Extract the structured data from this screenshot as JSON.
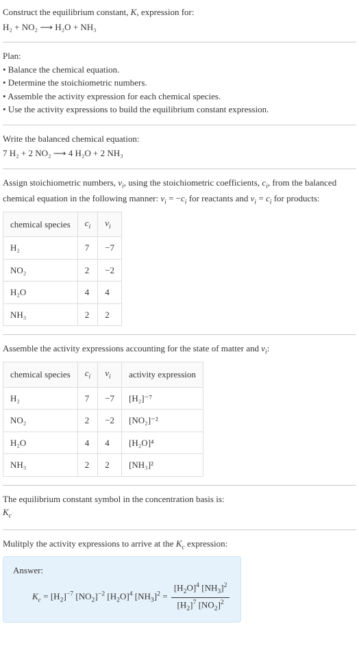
{
  "intro": {
    "line1": "Construct the equilibrium constant, K, expression for:",
    "equation": "H₂ + NO₂ ⟶ H₂O + NH₃"
  },
  "plan": {
    "heading": "Plan:",
    "b1": "• Balance the chemical equation.",
    "b2": "• Determine the stoichiometric numbers.",
    "b3": "• Assemble the activity expression for each chemical species.",
    "b4": "• Use the activity expressions to build the equilibrium constant expression."
  },
  "balanced": {
    "heading": "Write the balanced chemical equation:",
    "equation": "7 H₂ + 2 NO₂ ⟶ 4 H₂O + 2 NH₃"
  },
  "stoich": {
    "intro_a": "Assign stoichiometric numbers, νᵢ, using the stoichiometric coefficients, cᵢ, from the balanced chemical equation in the following manner: νᵢ = −cᵢ for reactants and νᵢ = cᵢ for products:",
    "headers": {
      "species": "chemical species",
      "c": "cᵢ",
      "v": "νᵢ"
    },
    "rows": [
      {
        "species": "H₂",
        "c": "7",
        "v": "−7"
      },
      {
        "species": "NO₂",
        "c": "2",
        "v": "−2"
      },
      {
        "species": "H₂O",
        "c": "4",
        "v": "4"
      },
      {
        "species": "NH₃",
        "c": "2",
        "v": "2"
      }
    ]
  },
  "activity": {
    "intro": "Assemble the activity expressions accounting for the state of matter and νᵢ:",
    "headers": {
      "species": "chemical species",
      "c": "cᵢ",
      "v": "νᵢ",
      "expr": "activity expression"
    },
    "rows": [
      {
        "species": "H₂",
        "c": "7",
        "v": "−7",
        "expr": "[H₂]⁻⁷"
      },
      {
        "species": "NO₂",
        "c": "2",
        "v": "−2",
        "expr": "[NO₂]⁻²"
      },
      {
        "species": "H₂O",
        "c": "4",
        "v": "4",
        "expr": "[H₂O]⁴"
      },
      {
        "species": "NH₃",
        "c": "2",
        "v": "2",
        "expr": "[NH₃]²"
      }
    ]
  },
  "symbol": {
    "line": "The equilibrium constant symbol in the concentration basis is:",
    "kc": "K_c"
  },
  "multiply": {
    "line": "Mulitply the activity expressions to arrive at the K_c expression:"
  },
  "answer": {
    "label": "Answer:",
    "lhs": "K_c = [H₂]⁻⁷ [NO₂]⁻² [H₂O]⁴ [NH₃]² = ",
    "num": "[H₂O]⁴ [NH₃]²",
    "den": "[H₂]⁷ [NO₂]²"
  }
}
